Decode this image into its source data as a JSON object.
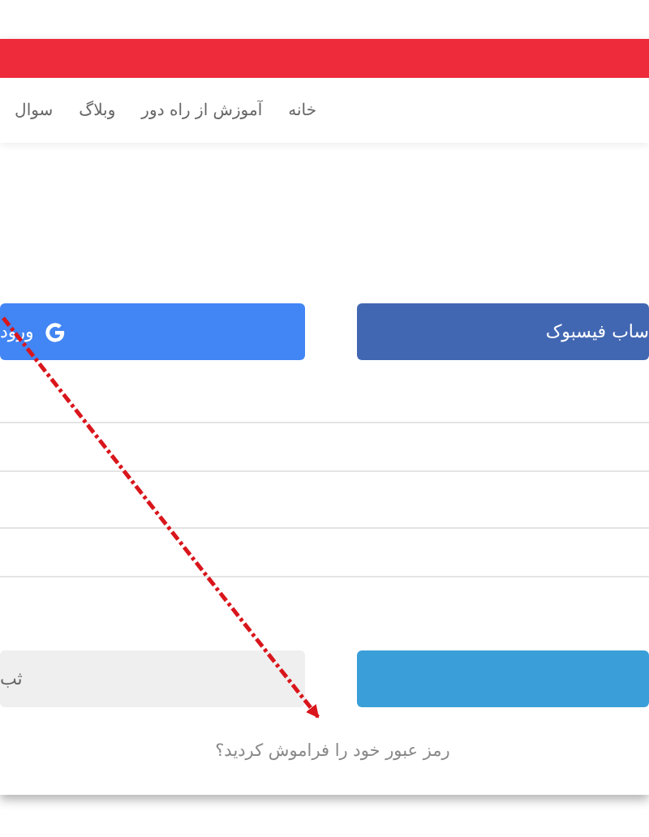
{
  "nav": {
    "items": [
      {
        "label": "خانه"
      },
      {
        "label": "آموزش از راه دور"
      },
      {
        "label": "وبلاگ"
      },
      {
        "label": "سوال"
      }
    ]
  },
  "social_buttons": [
    {
      "kind": "facebook",
      "label": "ساب فیسبوک"
    },
    {
      "kind": "google",
      "label": "ورود"
    }
  ],
  "register_button": {
    "label": "ثب"
  },
  "forgot_link": "رمز عبور خود را فراموش کردید؟"
}
